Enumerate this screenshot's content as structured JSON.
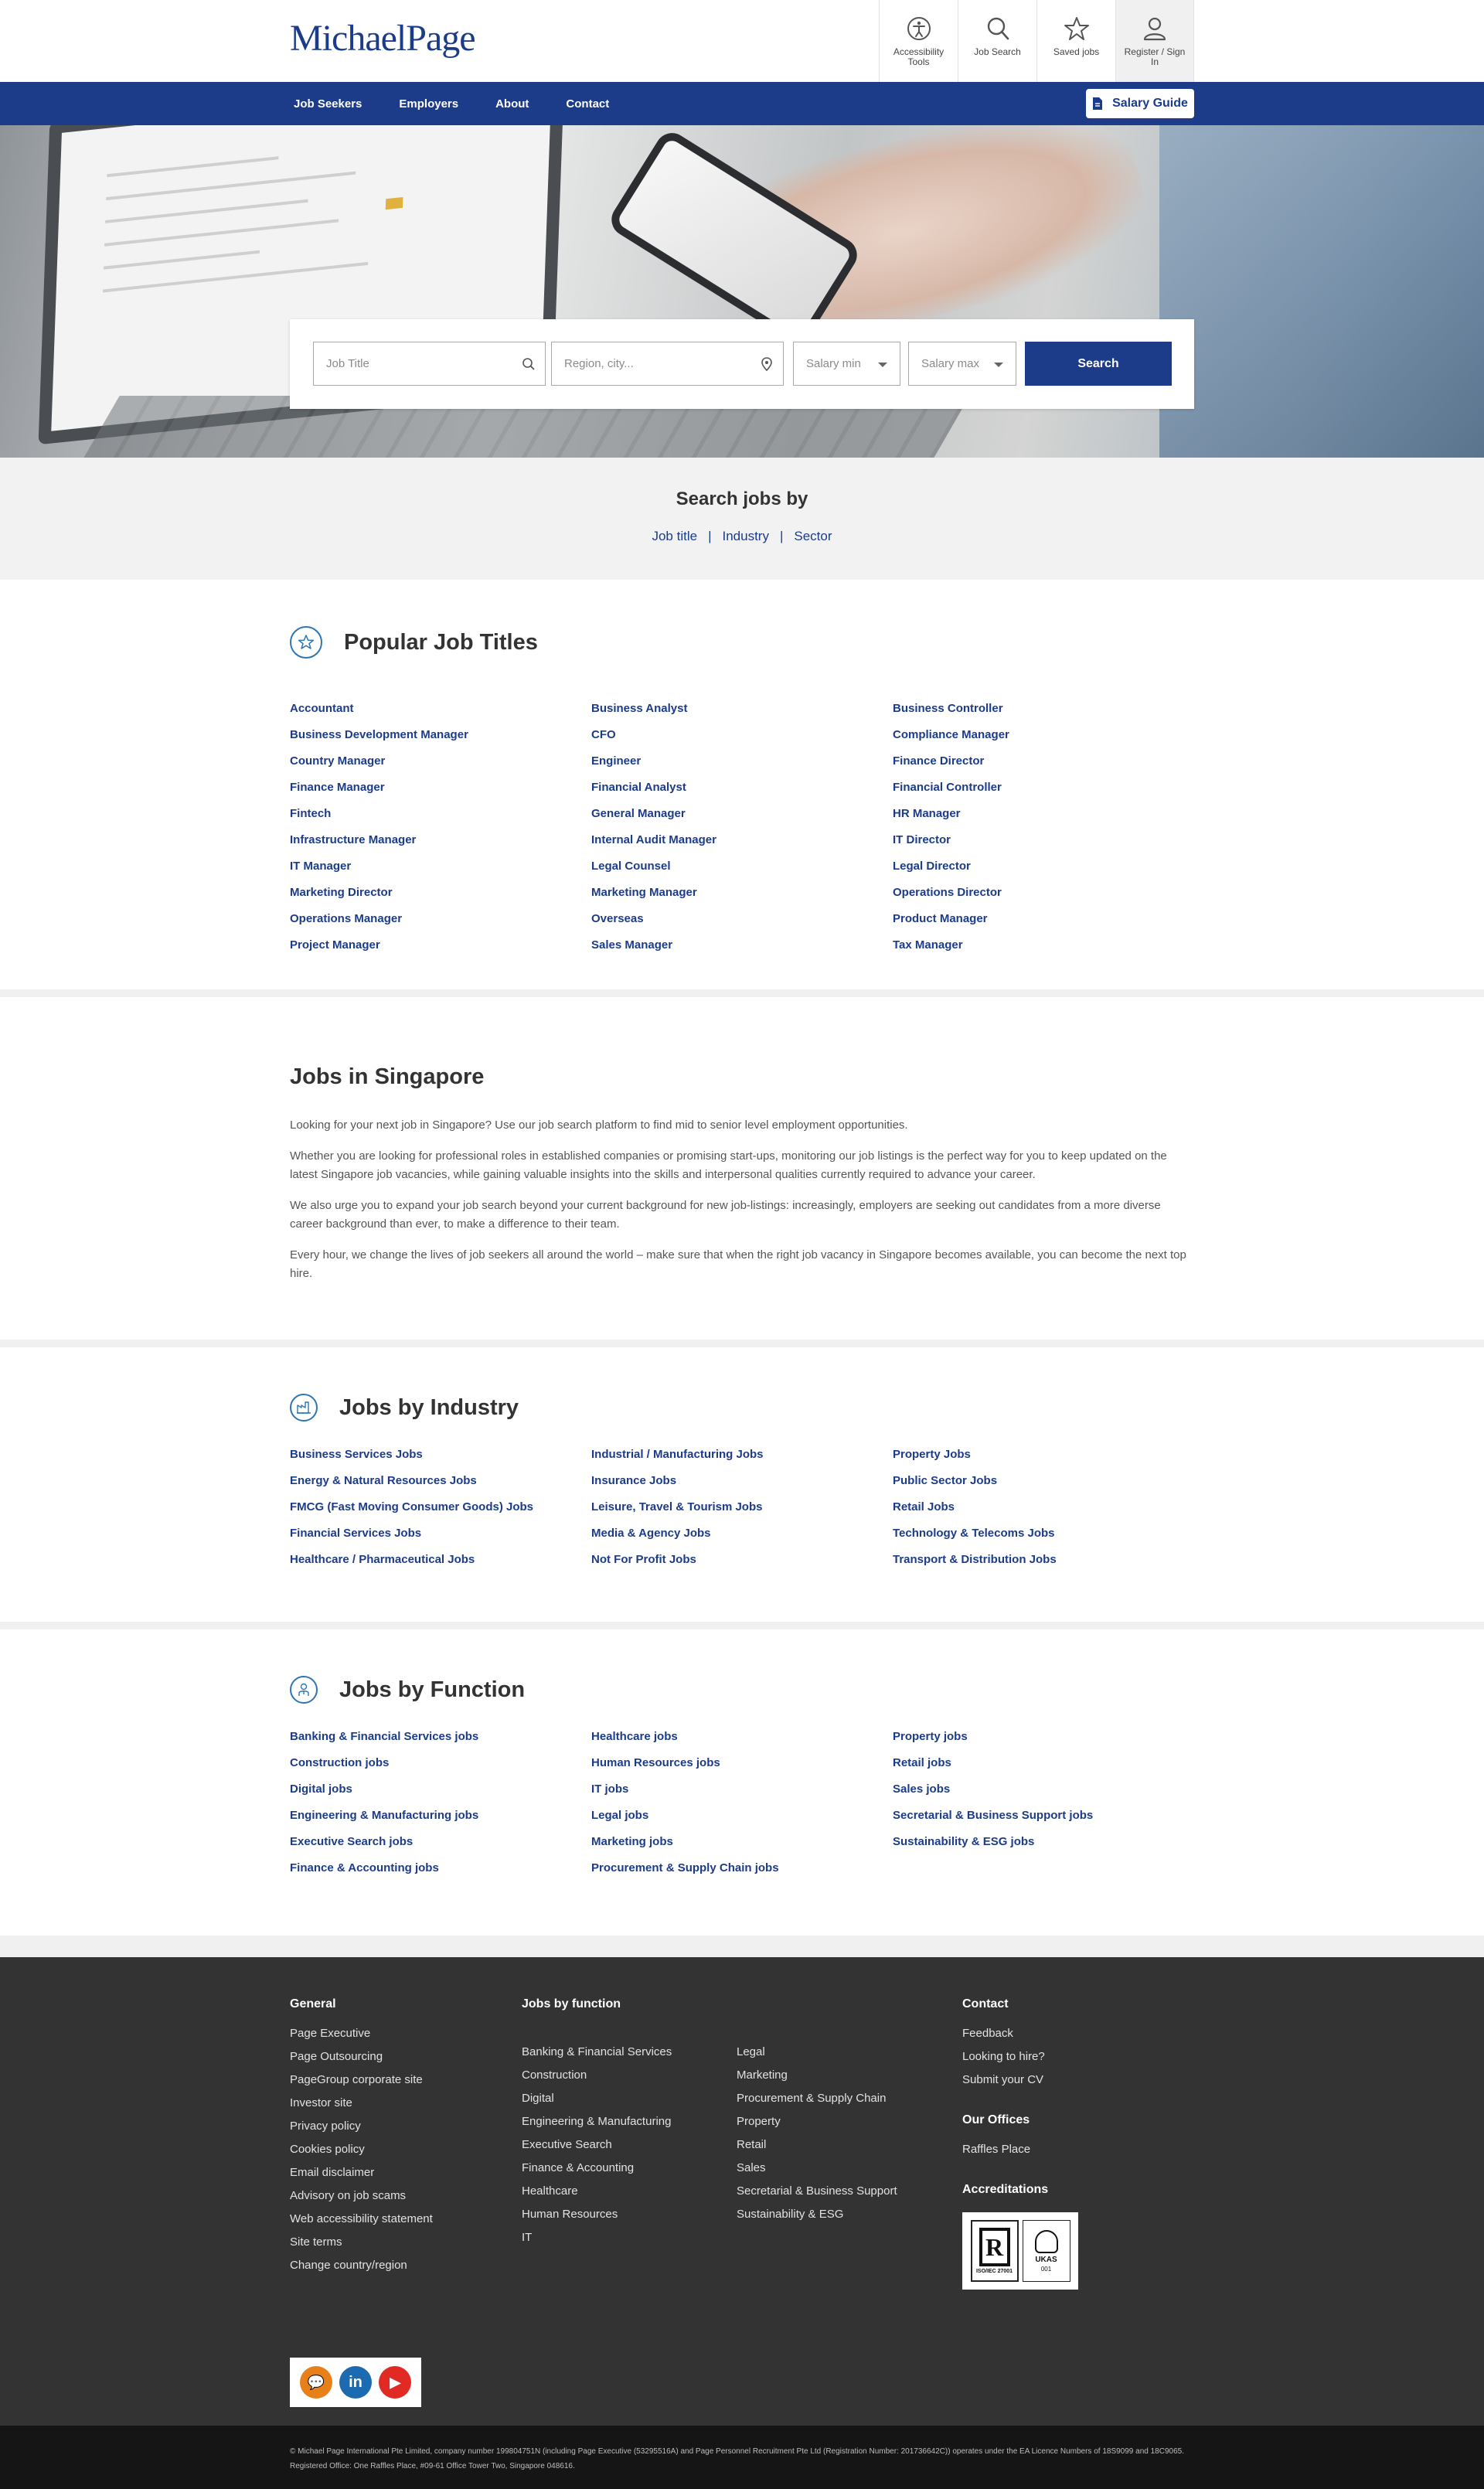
{
  "header": {
    "logo_part1": "Michael",
    "logo_part2": "Page",
    "tools": [
      {
        "label": "Accessibility Tools",
        "icon": "accessibility-icon"
      },
      {
        "label": "Job Search",
        "icon": "search-icon"
      },
      {
        "label": "Saved jobs",
        "icon": "star-icon"
      },
      {
        "label": "Register / Sign In",
        "icon": "user-icon"
      }
    ]
  },
  "nav": {
    "items": [
      "Job Seekers",
      "Employers",
      "About",
      "Contact"
    ],
    "salary_guide": "Salary Guide"
  },
  "search": {
    "job_title_placeholder": "Job Title",
    "region_placeholder": "Region, city...",
    "salary_min": "Salary min",
    "salary_max": "Salary max",
    "button": "Search"
  },
  "search_by": {
    "title": "Search jobs by",
    "links": [
      "Job title",
      "Industry",
      "Sector"
    ],
    "separator": "|"
  },
  "popular": {
    "title": "Popular Job Titles",
    "columns": [
      [
        "Accountant",
        "Business Development Manager",
        "Country Manager",
        "Finance Manager",
        "Fintech",
        "Infrastructure Manager",
        "IT Manager",
        "Marketing Director",
        "Operations Manager",
        "Project Manager"
      ],
      [
        "Business Analyst",
        "CFO",
        "Engineer",
        "Financial Analyst",
        "General Manager",
        "Internal Audit Manager",
        "Legal Counsel",
        "Marketing Manager",
        "Overseas",
        "Sales Manager"
      ],
      [
        "Business Controller",
        "Compliance Manager",
        "Finance Director",
        "Financial Controller",
        "HR Manager",
        "IT Director",
        "Legal Director",
        "Operations Director",
        "Product Manager",
        "Tax Manager"
      ]
    ]
  },
  "singapore": {
    "title": "Jobs in Singapore",
    "paragraphs": [
      "Looking for your next job in Singapore? Use our job search platform to find mid to senior level employment opportunities.",
      "Whether you are looking for professional roles in established companies or promising start-ups, monitoring our job listings is the perfect way for you to keep updated on the latest Singapore job vacancies, while gaining valuable insights into the skills and interpersonal qualities currently required to advance your career.",
      "We also urge you to expand your job search beyond your current background for new job-listings: increasingly, employers are seeking out candidates from a more diverse career background than ever, to make a difference to their team.",
      "Every hour, we change the lives of job seekers all around the world – make sure that when the right job vacancy in Singapore becomes available, you can become the next top hire."
    ]
  },
  "industry": {
    "title": "Jobs by Industry",
    "columns": [
      [
        "Business Services Jobs",
        "Energy & Natural Resources Jobs",
        "FMCG (Fast Moving Consumer Goods) Jobs",
        "Financial Services Jobs",
        "Healthcare / Pharmaceutical Jobs"
      ],
      [
        "Industrial / Manufacturing Jobs",
        "Insurance Jobs",
        "Leisure, Travel & Tourism Jobs",
        "Media & Agency Jobs",
        "Not For Profit Jobs"
      ],
      [
        "Property Jobs",
        "Public Sector Jobs",
        "Retail Jobs",
        "Technology & Telecoms Jobs",
        "Transport & Distribution Jobs"
      ]
    ]
  },
  "function": {
    "title": "Jobs by Function",
    "columns": [
      [
        "Banking & Financial Services jobs",
        "Construction jobs",
        "Digital jobs",
        "Engineering & Manufacturing jobs",
        "Executive Search jobs",
        "Finance & Accounting jobs"
      ],
      [
        "Healthcare jobs",
        "Human Resources jobs",
        "IT jobs",
        "Legal jobs",
        "Marketing jobs",
        "Procurement & Supply Chain jobs"
      ],
      [
        "Property jobs",
        "Retail jobs",
        "Sales jobs",
        "Secretarial & Business Support jobs",
        "Sustainability & ESG jobs"
      ]
    ]
  },
  "footer": {
    "general_title": "General",
    "general_links": [
      "Page Executive",
      "Page Outsourcing",
      "PageGroup corporate site",
      "Investor site",
      "Privacy policy",
      "Cookies policy",
      "Email disclaimer",
      "Advisory on job scams",
      "Web accessibility statement",
      "Site terms",
      "Change country/region"
    ],
    "jobs_title": "Jobs by function",
    "jobs_col1": [
      "Banking & Financial Services",
      "Construction",
      "Digital",
      "Engineering & Manufacturing",
      "Executive Search",
      "Finance & Accounting",
      "Healthcare",
      "Human Resources",
      "IT"
    ],
    "jobs_col2": [
      "Legal",
      "Marketing",
      "Procurement & Supply Chain",
      "Property",
      "Retail",
      "Sales",
      "Secretarial & Business Support",
      "Sustainability & ESG"
    ],
    "contact_title": "Contact",
    "contact_links": [
      "Feedback",
      "Looking to hire?",
      "Submit your CV"
    ],
    "offices_title": "Our Offices",
    "offices": [
      "Raffles Place"
    ],
    "accreditations_title": "Accreditations",
    "accred_r": "R",
    "accred_cert": "ISO/IEC 27001",
    "accred_ukas": "UKAS",
    "accred_num": "001",
    "social": [
      {
        "icon": "chat-icon",
        "glyph": "💬"
      },
      {
        "icon": "linkedin-icon",
        "glyph": "in"
      },
      {
        "icon": "youtube-icon",
        "glyph": "▶"
      }
    ],
    "legal": "© Michael Page International Pte Limited, company number 199804751N (including Page Executive (53295516A) and Page Personnel Recruitment Pte Ltd (Registration Number: 201736642C)) operates under the EA Licence Numbers of 18S9099 and 18C9065. Registered Office: One Raffles Place, #09-61 Office Tower Two, Singapore 048616."
  }
}
